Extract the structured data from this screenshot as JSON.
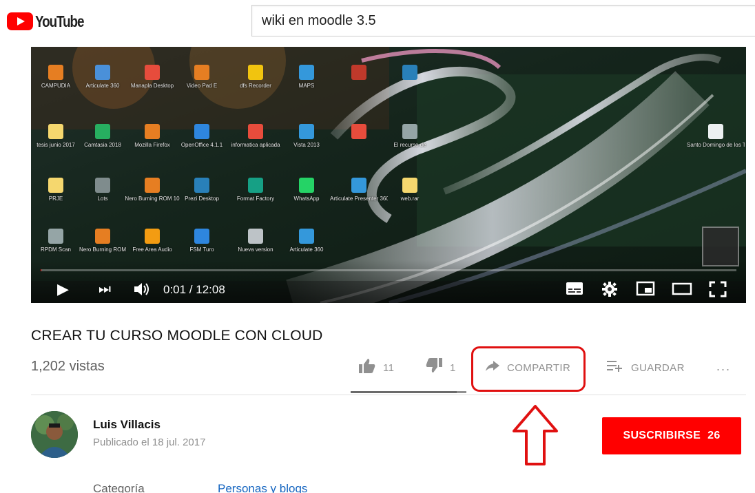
{
  "header": {
    "logo_text": "YouTube",
    "search_value": "wiki en moodle 3.5"
  },
  "player": {
    "time": "0:01 / 12:08",
    "progress_fraction": 0.0014,
    "desktop_icons": [
      {
        "label": "CAMPUDIA",
        "color": "#e67e22"
      },
      {
        "label": "Articulate 360",
        "color": "#4a90d9"
      },
      {
        "label": "Manapla Desktop",
        "color": "#e74c3c"
      },
      {
        "label": "Video Pad E",
        "color": "#e67e22"
      },
      {
        "label": "dfs Recorder",
        "color": "#f1c40f"
      },
      {
        "label": "MAPS",
        "color": "#3498db"
      },
      {
        "label": "",
        "color": "#c0392b"
      },
      {
        "label": "",
        "color": "#2980b9"
      },
      {
        "label": "tesis junio 2017",
        "color": "#f5d76e"
      },
      {
        "label": "Camtasia 2018",
        "color": "#27ae60"
      },
      {
        "label": "Mozilla Firefox",
        "color": "#e67e22"
      },
      {
        "label": "OpenOffice 4.1.1",
        "color": "#2e86de"
      },
      {
        "label": "informatica aplicada",
        "color": "#e74c3c"
      },
      {
        "label": "Vista 2013",
        "color": "#3498db"
      },
      {
        "label": "",
        "color": "#e74c3c"
      },
      {
        "label": "El recurso de",
        "color": "#95a5a6"
      },
      {
        "label": "PRJE",
        "color": "#f5d76e"
      },
      {
        "label": "Lots",
        "color": "#7f8c8d"
      },
      {
        "label": "Nero Burning ROM 10",
        "color": "#e67e22"
      },
      {
        "label": "Prezi Desktop",
        "color": "#2980b9"
      },
      {
        "label": "Format Factory",
        "color": "#16a085"
      },
      {
        "label": "WhatsApp",
        "color": "#25d366"
      },
      {
        "label": "Articulate Presenter 360",
        "color": "#3498db"
      },
      {
        "label": "web.rar",
        "color": "#f5d76e"
      },
      {
        "label": "RPDM Scan",
        "color": "#95a5a6"
      },
      {
        "label": "Nero Burning ROM",
        "color": "#e67e22"
      },
      {
        "label": "Free Area Audio",
        "color": "#f39c12"
      },
      {
        "label": "FSM Turo",
        "color": "#2e86de"
      },
      {
        "label": "Nueva version",
        "color": "#bdc3c7"
      },
      {
        "label": "Articulate 360",
        "color": "#3498db"
      }
    ],
    "right_desktop_icon": {
      "label": "Santo Domingo de los Tsachila",
      "color": "#ecf0f1"
    }
  },
  "video": {
    "title": "CREAR TU CURSO MOODLE CON CLOUD",
    "views": "1,202 vistas",
    "likes": "11",
    "dislikes": "1",
    "like_ratio": 0.917,
    "share_label": "COMPARTIR",
    "save_label": "GUARDAR",
    "more_label": "..."
  },
  "channel": {
    "name": "Luis Villacis",
    "published": "Publicado el 18 jul. 2017",
    "subscribe_label": "SUSCRIBIRSE",
    "subscriber_count": "26"
  },
  "meta": {
    "category_label": "Categoría",
    "category_value": "Personas y blogs"
  },
  "colors": {
    "brand_red": "#ff0000",
    "annotation_red": "#e01010",
    "link_blue": "#1565c0",
    "secondary_text": "#909090"
  }
}
